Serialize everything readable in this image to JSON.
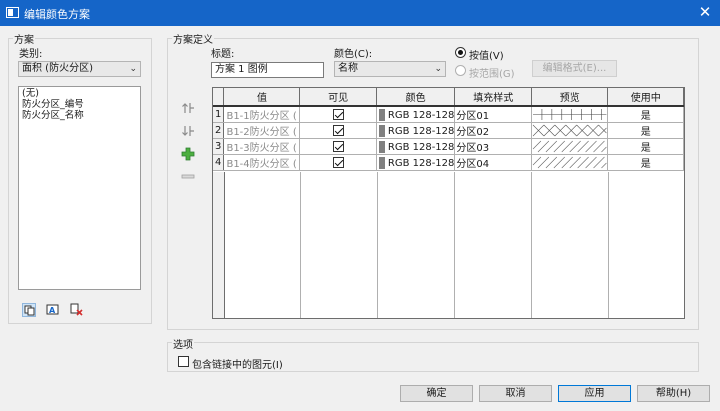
{
  "window": {
    "title": "编辑颜色方案",
    "close_label": "✕"
  },
  "scheme_panel": {
    "group_label": "方案",
    "category_label": "类别:",
    "category_value": "面积 (防火分区)",
    "schemes": [
      "(无)",
      "防火分区_编号",
      "防火分区_名称"
    ],
    "tool_icons": [
      "duplicate-scheme-icon",
      "rename-scheme-icon",
      "delete-scheme-icon"
    ]
  },
  "definition": {
    "group_label": "方案定义",
    "title_label": "标题:",
    "title_value": "方案 1 图例",
    "color_label": "颜色(C):",
    "color_value": "名称",
    "by_value_label": "按值(V)",
    "by_range_label": "按范围(G)",
    "edit_format_label": "编辑格式(E)...",
    "side_tools": [
      "move-up-icon",
      "move-down-icon",
      "add-value-icon",
      "remove-value-icon"
    ],
    "columns": [
      "",
      "值",
      "可见",
      "颜色",
      "填充样式",
      "预览",
      "使用中"
    ],
    "rows": [
      {
        "num": "1",
        "value": "B1-1防火分区 (",
        "visible": true,
        "color": "RGB 128-128",
        "fill": "分区01",
        "preview": "grid",
        "in_use": "是"
      },
      {
        "num": "2",
        "value": "B1-2防火分区 (",
        "visible": true,
        "color": "RGB 128-128",
        "fill": "分区02",
        "preview": "crosshatch",
        "in_use": "是"
      },
      {
        "num": "3",
        "value": "B1-3防火分区 (",
        "visible": true,
        "color": "RGB 128-128",
        "fill": "分区03",
        "preview": "diagonal",
        "in_use": "是"
      },
      {
        "num": "4",
        "value": "B1-4防火分区 (",
        "visible": true,
        "color": "RGB 128-128",
        "fill": "分区04",
        "preview": "diagonal",
        "in_use": "是"
      }
    ]
  },
  "options": {
    "group_label": "选项",
    "include_linked_label": "包含链接中的图元(I)",
    "include_linked_checked": false
  },
  "footer": {
    "ok": "确定",
    "cancel": "取消",
    "apply": "应用",
    "help": "帮助(H)"
  },
  "colors": {
    "titlebar": "#1565c8",
    "swatch": "#808080",
    "accent": "#0078d7"
  }
}
